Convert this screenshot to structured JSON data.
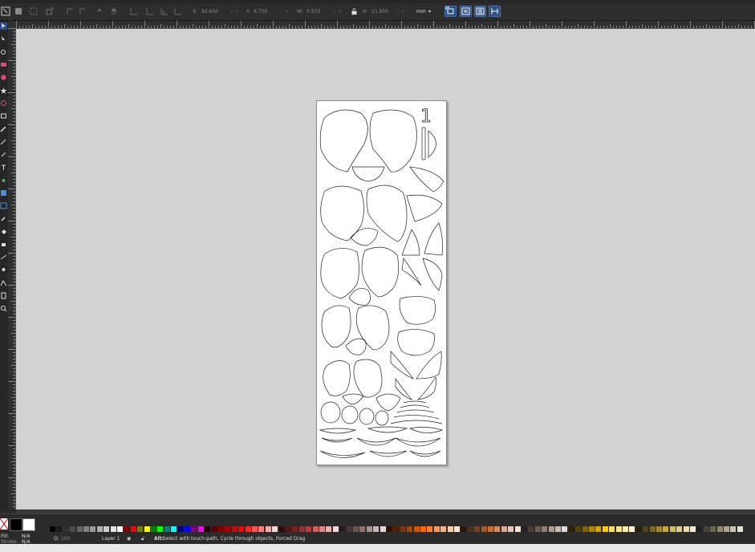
{
  "toolbar": {
    "x_label": "X:",
    "x_value": "92.650",
    "y_label": "Y:",
    "y_value": "4.750",
    "w_label": "W:",
    "w_value": "0.933",
    "h_label": "H:",
    "h_value": "21.950",
    "units": "mm"
  },
  "page": {
    "number_label": "1"
  },
  "fill_stroke": {
    "fill_label": "Fill:",
    "stroke_label": "Stroke:",
    "fill_value": "N/A",
    "stroke_value": "N/A",
    "opacity_label": "O:",
    "opacity_value": "100"
  },
  "status": {
    "layer_label": "Layer 1",
    "message_bold": "Alt:",
    "message": "Select with touch-path, Cycle through objects, Forced Drag"
  },
  "palette": {
    "colors": [
      "#000000",
      "#1a1a1a",
      "#333333",
      "#4d4d4d",
      "#666666",
      "#808080",
      "#999999",
      "#b3b3b3",
      "#cccccc",
      "#e6e6e6",
      "#ffffff",
      "#800000",
      "#ff0000",
      "#808000",
      "#ffff00",
      "#008000",
      "#00ff00",
      "#008080",
      "#00ffff",
      "#000080",
      "#0000ff",
      "#800080",
      "#ff00ff",
      "#2b0000",
      "#550000",
      "#800000",
      "#aa0000",
      "#d40000",
      "#ff0000",
      "#ff2a2a",
      "#ff5555",
      "#ff8080",
      "#ffaaaa",
      "#ffd5d5",
      "#280b0b",
      "#501616",
      "#782121",
      "#a02c2c",
      "#c83737",
      "#d35f5f",
      "#de8787",
      "#e9afaf",
      "#f4d7d7",
      "#241c1c",
      "#483737",
      "#6c5353",
      "#916f6f",
      "#ac9393",
      "#c8b7b7",
      "#e3dbdb",
      "#2b1100",
      "#552200",
      "#803300",
      "#aa4400",
      "#d45500",
      "#ff6600",
      "#ff7f2a",
      "#ff9955",
      "#ffb380",
      "#ffccaa",
      "#ffe6d5",
      "#28170b",
      "#502d16",
      "#784421",
      "#a05a2c",
      "#c87137",
      "#d38d5f",
      "#deaa87",
      "#e9c6af",
      "#f4e3d7",
      "#241f1c",
      "#483e37",
      "#6c5d53",
      "#917c6f",
      "#ac9d93",
      "#c8beb7",
      "#e3dedb",
      "#2b2200",
      "#554400",
      "#806600",
      "#aa8800",
      "#d4aa00",
      "#ffcc00",
      "#ffdd55",
      "#ffe680",
      "#ffeeaa",
      "#fff6d5",
      "#28220b",
      "#504416",
      "#786721",
      "#a0892c",
      "#c8ab37",
      "#d3bc5f",
      "#decd87",
      "#e9ddaf",
      "#f4eed7",
      "#24221c",
      "#484537",
      "#6c6753",
      "#918a6f",
      "#aca793",
      "#c8c4b7",
      "#e3e2db"
    ]
  }
}
